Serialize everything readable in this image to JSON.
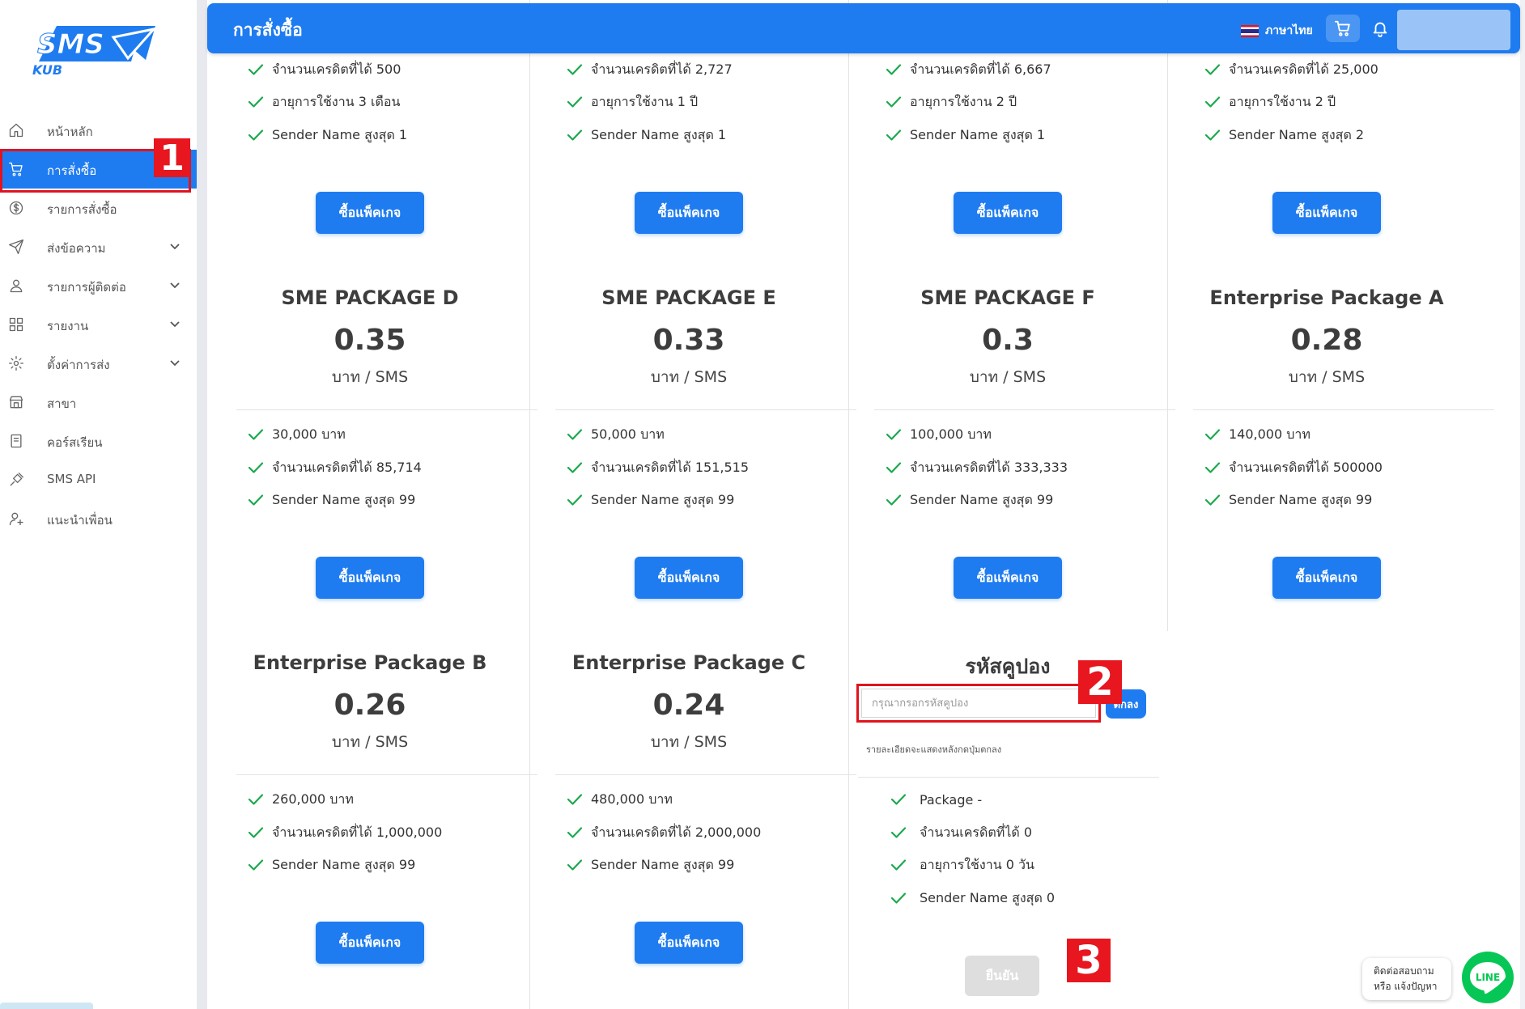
{
  "logo": {
    "text": "SMS",
    "sub": "KUB"
  },
  "sidebar": {
    "items": [
      {
        "label": "หน้าหลัก",
        "icon": "home-icon",
        "has_submenu": false,
        "active": false
      },
      {
        "label": "การสั่งซื้อ",
        "icon": "cart-icon",
        "has_submenu": false,
        "active": true
      },
      {
        "label": "รายการสั่งซื้อ",
        "icon": "dollar-circle-icon",
        "has_submenu": false,
        "active": false
      },
      {
        "label": "ส่งข้อความ",
        "icon": "send-icon",
        "has_submenu": true,
        "active": false
      },
      {
        "label": "รายการผู้ติดต่อ",
        "icon": "user-icon",
        "has_submenu": true,
        "active": false
      },
      {
        "label": "รายงาน",
        "icon": "grid-icon",
        "has_submenu": true,
        "active": false
      },
      {
        "label": "ตั้งค่าการส่ง",
        "icon": "gear-icon",
        "has_submenu": true,
        "active": false
      },
      {
        "label": "สาขา",
        "icon": "store-icon",
        "has_submenu": false,
        "active": false
      },
      {
        "label": "คอร์สเรียน",
        "icon": "book-icon",
        "has_submenu": false,
        "active": false
      },
      {
        "label": "SMS API",
        "icon": "plug-icon",
        "has_submenu": false,
        "active": false
      },
      {
        "label": "แนะนำเพื่อน",
        "icon": "add-user-icon",
        "has_submenu": false,
        "active": false
      }
    ]
  },
  "header": {
    "title": "การสั่งซื้อ",
    "language": "ภาษาไทย",
    "accent_color": "#1f7cf0"
  },
  "markers": [
    "1",
    "2",
    "3"
  ],
  "top_row": [
    {
      "features": [
        "จำนวนเครดิตที่ได้ 500",
        "อายุการใช้งาน 3 เดือน",
        "Sender Name สูงสุด 1"
      ],
      "buy_label": "ซื้อแพ็คเกจ"
    },
    {
      "features": [
        "จำนวนเครดิตที่ได้ 2,727",
        "อายุการใช้งาน 1 ปี",
        "Sender Name สูงสุด 1"
      ],
      "buy_label": "ซื้อแพ็คเกจ"
    },
    {
      "features": [
        "จำนวนเครดิตที่ได้ 6,667",
        "อายุการใช้งาน 2 ปี",
        "Sender Name สูงสุด 1"
      ],
      "buy_label": "ซื้อแพ็คเกจ"
    },
    {
      "features": [
        "จำนวนเครดิตที่ได้ 25,000",
        "อายุการใช้งาน 2 ปี",
        "Sender Name สูงสุด 2"
      ],
      "buy_label": "ซื้อแพ็คเกจ"
    }
  ],
  "middle_row": [
    {
      "name": "SME PACKAGE D",
      "price": "0.35",
      "unit": "บาท / SMS",
      "features": [
        "30,000 บาท",
        "จำนวนเครดิตที่ได้ 85,714",
        "Sender Name สูงสุด 99"
      ],
      "buy_label": "ซื้อแพ็คเกจ"
    },
    {
      "name": "SME PACKAGE E",
      "price": "0.33",
      "unit": "บาท / SMS",
      "features": [
        "50,000 บาท",
        "จำนวนเครดิตที่ได้ 151,515",
        "Sender Name สูงสุด 99"
      ],
      "buy_label": "ซื้อแพ็คเกจ"
    },
    {
      "name": "SME PACKAGE F",
      "price": "0.3",
      "unit": "บาท / SMS",
      "features": [
        "100,000 บาท",
        "จำนวนเครดิตที่ได้ 333,333",
        "Sender Name สูงสุด 99"
      ],
      "buy_label": "ซื้อแพ็คเกจ"
    },
    {
      "name": "Enterprise Package A",
      "price": "0.28",
      "unit": "บาท / SMS",
      "features": [
        "140,000 บาท",
        "จำนวนเครดิตที่ได้ 500000",
        "Sender Name สูงสุด 99"
      ],
      "buy_label": "ซื้อแพ็คเกจ"
    }
  ],
  "bottom_row": [
    {
      "name": "Enterprise Package B",
      "price": "0.26",
      "unit": "บาท / SMS",
      "features": [
        "260,000 บาท",
        "จำนวนเครดิตที่ได้ 1,000,000",
        "Sender Name สูงสุด 99"
      ],
      "buy_label": "ซื้อแพ็คเกจ"
    },
    {
      "name": "Enterprise Package C",
      "price": "0.24",
      "unit": "บาท / SMS",
      "features": [
        "480,000 บาท",
        "จำนวนเครดิตที่ได้ 2,000,000",
        "Sender Name สูงสุด 99"
      ],
      "buy_label": "ซื้อแพ็คเกจ"
    }
  ],
  "coupon": {
    "title": "รหัสคูปอง",
    "placeholder": "กรุณากรอกรหัสคูปอง",
    "value": "",
    "ok_label": "ตกลง",
    "note": "รายละเอียดจะแสดงหลังกดปุ่มตกลง",
    "features": [
      "Package -",
      "จำนวนเครดิตที่ได้ 0",
      "อายุการใช้งาน 0 วัน",
      "Sender Name สูงสุด 0"
    ],
    "confirm_label": "ยืนยัน"
  },
  "contact": {
    "line1": "ติดต่อสอบถาม",
    "line2": "หรือ แจ้งปัญหา",
    "line_label": "LINE"
  }
}
